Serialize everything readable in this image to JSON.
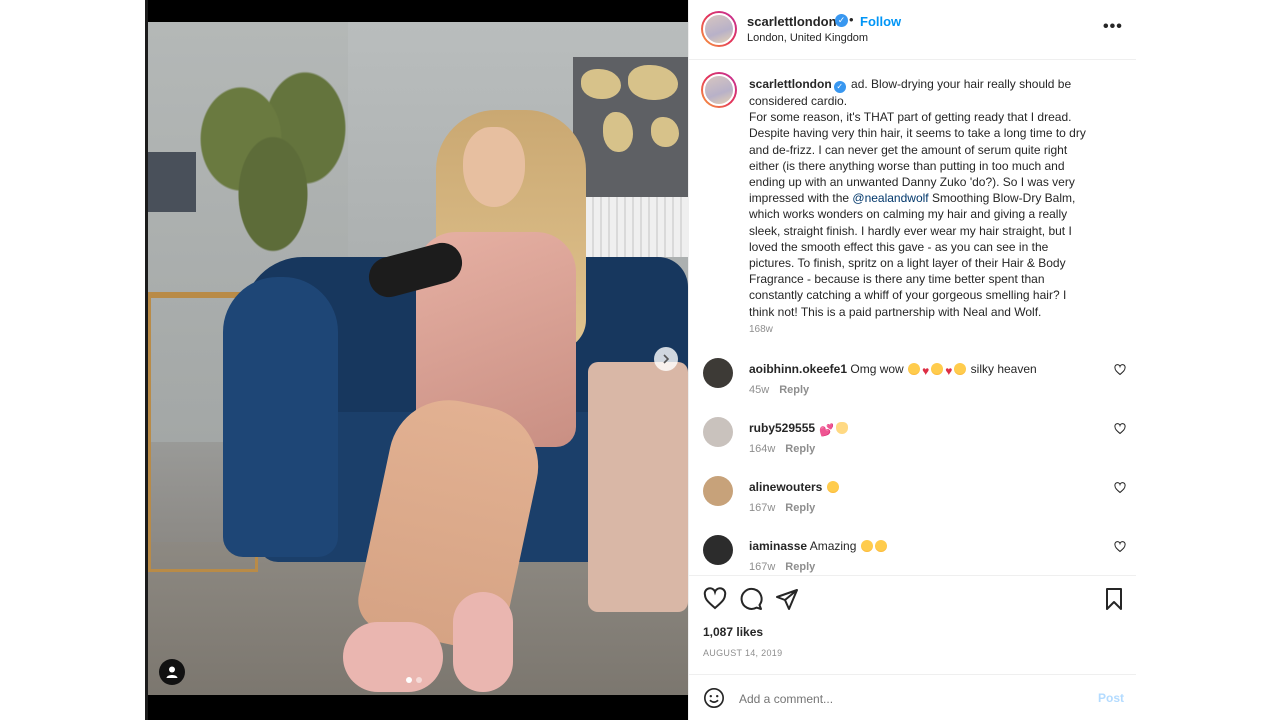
{
  "post": {
    "username": "scarlettlondon",
    "follow_label": "Follow",
    "location": "London, United Kingdom",
    "more_label": "•••",
    "caption_lines": [
      "ad. Blow-drying your hair really should be",
      "considered cardio.",
      "For some reason, it's THAT part of getting ready that I dread.",
      "Despite having very thin hair, it seems to take a long time to dry",
      "and de-frizz. I can never get the amount of serum quite right",
      "either (is there anything worse than putting in too much and",
      "ending up with an unwanted Danny Zuko 'do?). So I was very",
      "impressed with the",
      "Smoothing Blow-Dry Balm,",
      "which works wonders on calming my hair and giving a really",
      "sleek, straight finish. I hardly ever wear my hair straight, but I",
      "loved the smooth effect this gave - as you can see in the",
      "pictures. To finish, spritz on a light layer of their Hair & Body",
      "Fragrance - because is there any time better spent than",
      "constantly catching a whiff of your gorgeous smelling hair? I",
      "think not! This is a paid partnership with Neal and Wolf."
    ],
    "mention": "@nealandwolf",
    "caption_time": "168w",
    "likes": "1,087 likes",
    "date": "AUGUST 14, 2019",
    "add_comment_placeholder": "Add a comment...",
    "post_label": "Post"
  },
  "comments": [
    {
      "username": "aoibhinn.okeefe1",
      "text": "Omg wow",
      "emoji": [
        "heart-eyes",
        "heart",
        "heart-eyes",
        "heart",
        "heart-eyes"
      ],
      "trailing": "silky heaven",
      "time": "45w",
      "reply": "Reply",
      "avatar_color": "#3d3a36"
    },
    {
      "username": "ruby529555",
      "text": "",
      "emoji": [
        "pink-hearts",
        "raising-hands"
      ],
      "trailing": "",
      "time": "164w",
      "reply": "Reply",
      "avatar_color": "#c9c2bd"
    },
    {
      "username": "alinewouters",
      "text": "",
      "emoji": [
        "heart-eyes"
      ],
      "trailing": "",
      "time": "167w",
      "reply": "Reply",
      "avatar_color": "#c7a27a"
    },
    {
      "username": "iaminasse",
      "text": "Amazing",
      "emoji": [
        "heart-eyes",
        "heart-eyes"
      ],
      "trailing": "",
      "time": "167w",
      "reply": "Reply",
      "avatar_color": "#2c2c2c"
    }
  ],
  "colors": {
    "accent": "#0095f6",
    "verified": "#3897f0",
    "muted": "#8e8e8e",
    "post_disabled": "#b3dbff"
  },
  "icons": [
    "more-icon",
    "verified-icon",
    "next-arrow-icon",
    "user-tag-icon",
    "heart-icon",
    "comment-icon",
    "share-icon",
    "bookmark-icon",
    "emoji-icon"
  ]
}
